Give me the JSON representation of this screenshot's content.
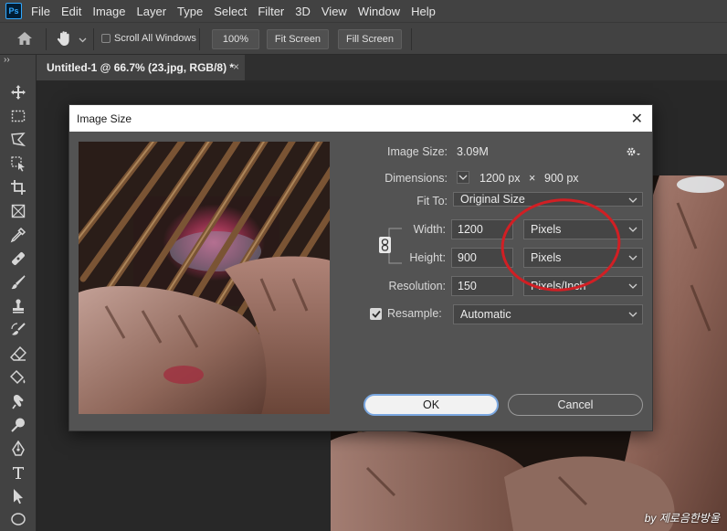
{
  "app": {
    "logo_text": "Ps"
  },
  "menubar": {
    "items": [
      "File",
      "Edit",
      "Image",
      "Layer",
      "Type",
      "Select",
      "Filter",
      "3D",
      "View",
      "Window",
      "Help"
    ]
  },
  "options_bar": {
    "scroll_all_label": "Scroll All Windows",
    "scroll_all_checked": false,
    "zoom_button": "100%",
    "fit_screen_button": "Fit Screen",
    "fill_screen_button": "Fill Screen"
  },
  "document_tab": {
    "title": "Untitled-1 @ 66.7% (23.jpg, RGB/8) *",
    "close": "×"
  },
  "toolbox": {
    "collapse": "››"
  },
  "dialog": {
    "title": "Image Size",
    "close": "✕",
    "image_size_label": "Image Size:",
    "image_size_value": "3.09M",
    "dimensions_label": "Dimensions:",
    "dimensions_width": "1200 px",
    "dimensions_times": "×",
    "dimensions_height": "900 px",
    "fit_to_label": "Fit To:",
    "fit_to_value": "Original Size",
    "width_label": "Width:",
    "width_value": "1200",
    "width_unit": "Pixels",
    "height_label": "Height:",
    "height_value": "900",
    "height_unit": "Pixels",
    "resolution_label": "Resolution:",
    "resolution_value": "150",
    "resolution_unit": "Pixels/Inch",
    "resample_label": "Resample:",
    "resample_checked": true,
    "resample_value": "Automatic",
    "ok_button": "OK",
    "cancel_button": "Cancel"
  },
  "watermark": "by 제로음한방울",
  "colors": {
    "annotation_circle": "#d11f24",
    "ok_outline": "#7aa7e0",
    "ps_blue": "#31a8ff"
  }
}
